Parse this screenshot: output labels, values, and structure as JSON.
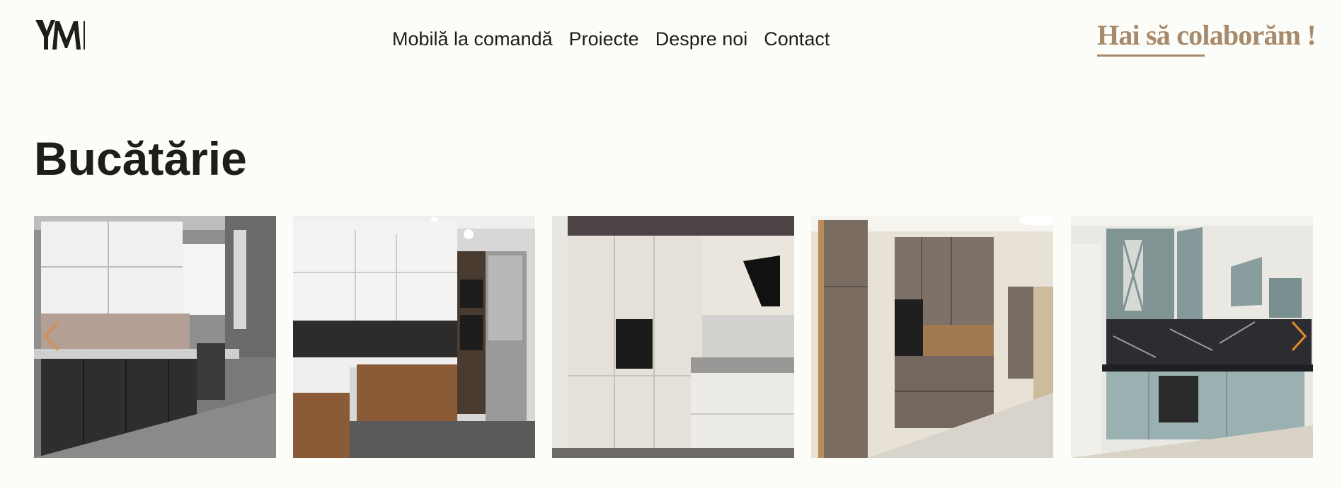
{
  "header": {
    "logo_text": "YM",
    "nav": [
      {
        "label": "Mobilă la comandă"
      },
      {
        "label": "Proiecte"
      },
      {
        "label": "Despre noi"
      },
      {
        "label": "Contact"
      }
    ],
    "cta_label": "Hai să colaborăm !"
  },
  "page": {
    "title": "Bucătărie"
  },
  "gallery": {
    "slides": [
      {
        "name": "kitchen-photo-white-dark-grey"
      },
      {
        "name": "kitchen-photo-white-wood"
      },
      {
        "name": "kitchen-photo-beige-gloss"
      },
      {
        "name": "kitchen-photo-taupe"
      },
      {
        "name": "kitchen-photo-sage-green"
      }
    ],
    "prev_icon": "chevron-left-icon",
    "next_icon": "chevron-right-icon"
  },
  "colors": {
    "background": "#fcfdf8",
    "text": "#1d1d1b",
    "accent": "#a78a6c",
    "arrow": "#e8892c"
  }
}
